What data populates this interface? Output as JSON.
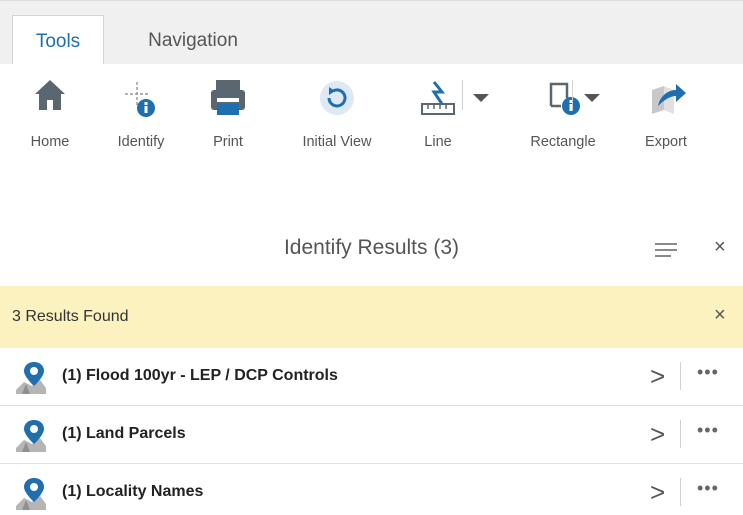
{
  "tabs": [
    {
      "label": "Tools",
      "active": true
    },
    {
      "label": "Navigation",
      "active": false
    }
  ],
  "toolbar": {
    "home": "Home",
    "identify": "Identify",
    "print": "Print",
    "initial_view": "Initial View",
    "line": "Line",
    "rectangle": "Rectangle",
    "export": "Export"
  },
  "results": {
    "title": "Identify Results (3)",
    "banner": "3 Results Found",
    "items": [
      {
        "label": "(1) Flood 100yr - LEP / DCP Controls"
      },
      {
        "label": "(1) Land Parcels"
      },
      {
        "label": "(1) Locality Names"
      }
    ]
  },
  "icons": {
    "close": "×",
    "chevron": ">",
    "more": "•••"
  },
  "colors": {
    "accent": "#1e6fae",
    "banner": "#fcf2c0",
    "icon_grey": "#5b6770"
  }
}
